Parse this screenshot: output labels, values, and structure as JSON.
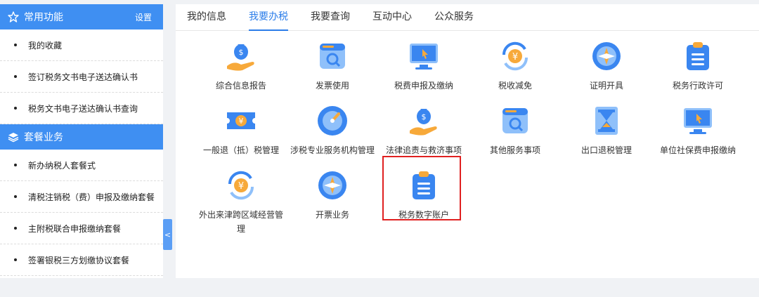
{
  "sidebar": {
    "section1": {
      "title": "常用功能",
      "link": "设置",
      "icon": "star-icon"
    },
    "section1_items": [
      {
        "label": "我的收藏"
      },
      {
        "label": "签订税务文书电子送达确认书"
      },
      {
        "label": "税务文书电子送达确认书查询"
      }
    ],
    "section2": {
      "title": "套餐业务",
      "icon": "layers-icon"
    },
    "section2_items": [
      {
        "label": "新办纳税人套餐式"
      },
      {
        "label": "清税注销税（费）申报及缴纳套餐"
      },
      {
        "label": "主附税联合申报缴纳套餐"
      },
      {
        "label": "签署银税三方划缴协议套餐"
      }
    ],
    "collapse_glyph": "<"
  },
  "tabs": [
    {
      "label": "我的信息"
    },
    {
      "label": "我要办税"
    },
    {
      "label": "我要查询"
    },
    {
      "label": "互动中心"
    },
    {
      "label": "公众服务"
    }
  ],
  "active_tab": "我要办税",
  "tiles": [
    {
      "label": "综合信息报告",
      "icon": "money-bag-hand-icon"
    },
    {
      "label": "发票使用",
      "icon": "invoice-search-icon"
    },
    {
      "label": "税费申报及缴纳",
      "icon": "monitor-cursor-icon"
    },
    {
      "label": "税收减免",
      "icon": "yen-cycle-icon"
    },
    {
      "label": "证明开具",
      "icon": "compass-icon"
    },
    {
      "label": "税务行政许可",
      "icon": "clipboard-icon"
    },
    {
      "label": "一般退（抵）税管理",
      "icon": "yen-ticket-icon"
    },
    {
      "label": "涉税专业服务机构管理",
      "icon": "gauge-icon"
    },
    {
      "label": "法律追责与救济事项",
      "icon": "money-bag-hand-icon"
    },
    {
      "label": "其他服务事项",
      "icon": "invoice-search-icon"
    },
    {
      "label": "出口退税管理",
      "icon": "hourglass-icon"
    },
    {
      "label": "单位社保费申报缴纳",
      "icon": "monitor-cursor-icon"
    },
    {
      "label": "外出来津跨区域经营管理",
      "icon": "yen-cycle-icon"
    },
    {
      "label": "开票业务",
      "icon": "compass-icon"
    },
    {
      "label": "税务数字账户",
      "icon": "clipboard-icon"
    }
  ],
  "colors": {
    "accent": "#3f8ff2",
    "highlight": "#e02020",
    "icon_blue": "#3a86f0",
    "icon_orange": "#f7a93a"
  }
}
